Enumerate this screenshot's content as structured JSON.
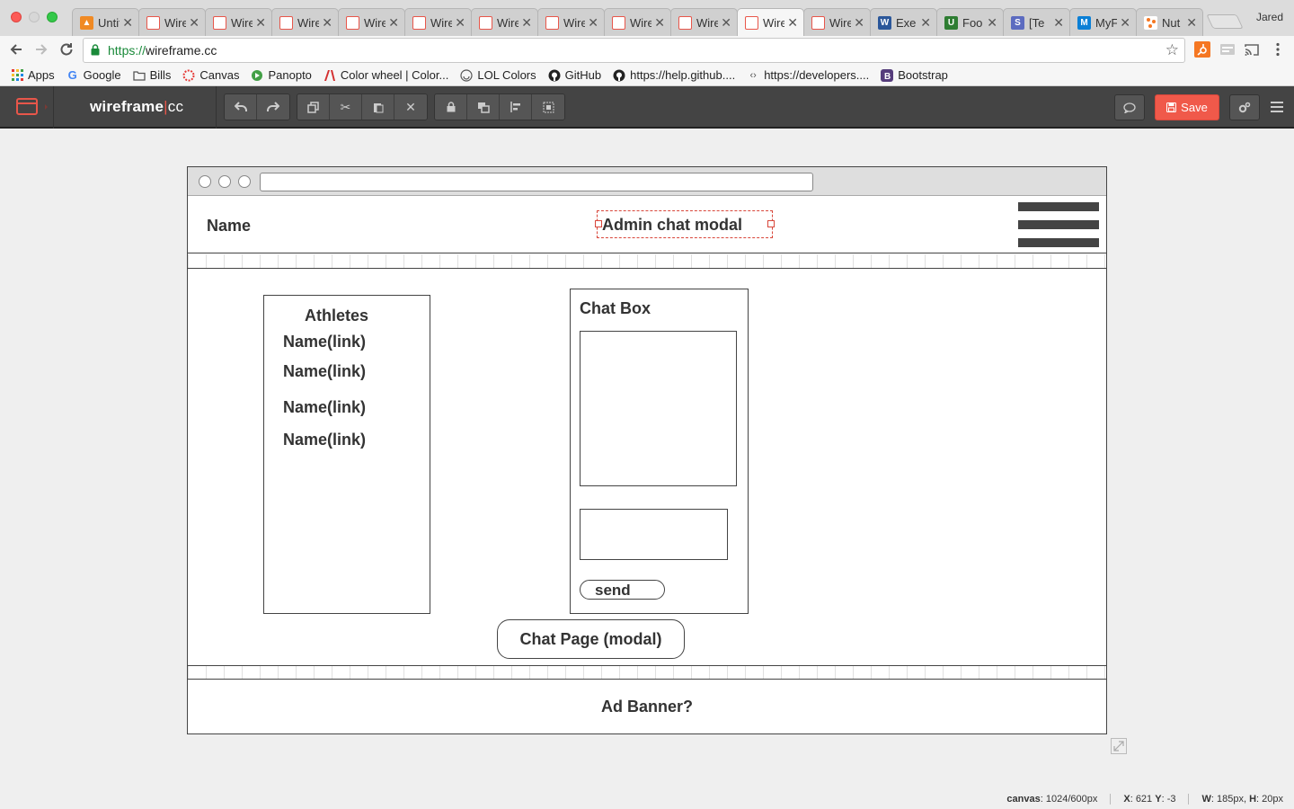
{
  "browser": {
    "tabs": [
      {
        "title": "Untitled",
        "icon": "orange",
        "active": false
      },
      {
        "title": "Wireframe",
        "icon": "wireframe",
        "active": false
      },
      {
        "title": "Wireframe",
        "icon": "wireframe",
        "active": false
      },
      {
        "title": "Wireframe",
        "icon": "wireframe",
        "active": false
      },
      {
        "title": "Wireframe",
        "icon": "wireframe",
        "active": false
      },
      {
        "title": "Wireframe",
        "icon": "wireframe",
        "active": false
      },
      {
        "title": "Wireframe",
        "icon": "wireframe",
        "active": false
      },
      {
        "title": "Wireframe",
        "icon": "wireframe",
        "active": false
      },
      {
        "title": "Wireframe",
        "icon": "wireframe",
        "active": false
      },
      {
        "title": "Wireframe",
        "icon": "wireframe",
        "active": false
      },
      {
        "title": "Wireframe",
        "icon": "wireframe",
        "active": true
      },
      {
        "title": "Wireframe",
        "icon": "wireframe",
        "active": false
      },
      {
        "title": "Exe",
        "icon": "word",
        "active": false
      },
      {
        "title": "Foo",
        "icon": "usda",
        "active": false
      },
      {
        "title": "[Te",
        "icon": "s",
        "active": false
      },
      {
        "title": "MyF",
        "icon": "myfitness",
        "active": false
      },
      {
        "title": "Nut",
        "icon": "nut",
        "active": false
      }
    ],
    "profile_name": "Jared",
    "url_scheme": "https://",
    "url_host": "wireframe.cc",
    "bookmarks": [
      {
        "label": "Apps",
        "icon": "apps-grid-icon"
      },
      {
        "label": "Google",
        "icon": "google-icon"
      },
      {
        "label": "Bills",
        "icon": "folder-icon"
      },
      {
        "label": "Canvas",
        "icon": "canvas-icon"
      },
      {
        "label": "Panopto",
        "icon": "panopto-icon"
      },
      {
        "label": "Color wheel | Color...",
        "icon": "adobe-icon"
      },
      {
        "label": "LOL Colors",
        "icon": "lol-icon"
      },
      {
        "label": "GitHub",
        "icon": "github-icon"
      },
      {
        "label": "https://help.github....",
        "icon": "github-icon"
      },
      {
        "label": "https://developers....",
        "icon": "code-icon"
      },
      {
        "label": "Bootstrap",
        "icon": "bootstrap-icon"
      }
    ]
  },
  "app": {
    "brand_main": "wireframe",
    "brand_sep": "|",
    "brand_suffix": "cc",
    "save_label": "Save",
    "accent_color": "#f0594a"
  },
  "wireframe": {
    "header_name": "Name",
    "header_title": "Admin chat modal",
    "athletes_title": "Athletes",
    "athlete_links": [
      "Name(link)",
      "Name(link)",
      "Name(link)",
      "Name(link)"
    ],
    "chatbox_title": "Chat Box",
    "send_label": "send",
    "chat_page_label": "Chat Page (modal)",
    "ad_banner_label": "Ad Banner?"
  },
  "status": {
    "canvas_label": "canvas",
    "canvas_value": ": 1024/600px",
    "x_label": "X",
    "x_value": ": 621",
    "y_label": "Y",
    "y_value": ": -3",
    "w_label": "W",
    "w_value": ": 185px,",
    "h_label": "H",
    "h_value": ": 20px"
  }
}
